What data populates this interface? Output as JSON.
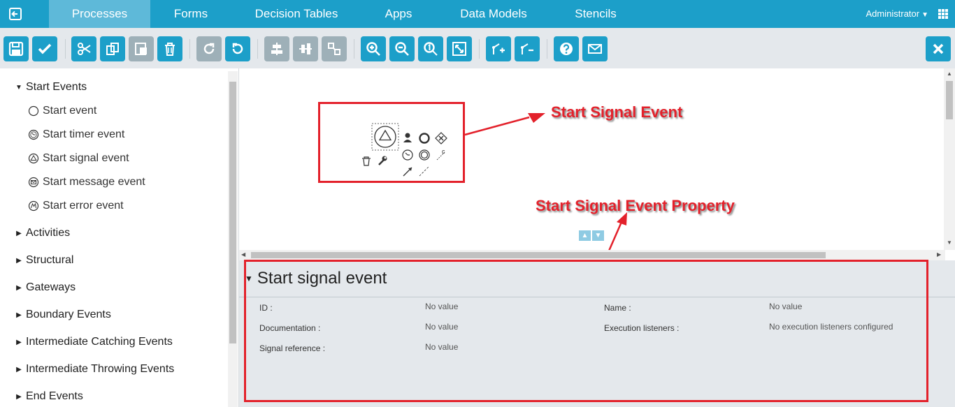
{
  "nav": {
    "tabs": [
      "Processes",
      "Forms",
      "Decision Tables",
      "Apps",
      "Data Models",
      "Stencils"
    ],
    "active_tab": "Processes",
    "user": "Administrator"
  },
  "toolbar": {
    "buttons": [
      "save",
      "validate",
      "cut",
      "copy",
      "paste",
      "delete",
      "redo",
      "undo",
      "align-vertical",
      "align-horizontal",
      "same-size",
      "zoom-in",
      "zoom-out",
      "zoom-actual",
      "zoom-fit",
      "bendpoint-add",
      "bendpoint-remove",
      "help",
      "feedback",
      "close"
    ]
  },
  "palette": {
    "groups": [
      {
        "label": "Start Events",
        "expanded": true,
        "items": [
          "Start event",
          "Start timer event",
          "Start signal event",
          "Start message event",
          "Start error event"
        ]
      },
      {
        "label": "Activities"
      },
      {
        "label": "Structural"
      },
      {
        "label": "Gateways"
      },
      {
        "label": "Boundary Events"
      },
      {
        "label": "Intermediate Catching Events"
      },
      {
        "label": "Intermediate Throwing Events"
      },
      {
        "label": "End Events"
      }
    ]
  },
  "annotations": {
    "signal_event": "Start  Signal Event",
    "signal_property": "Start Signal Event Property"
  },
  "properties": {
    "title": "Start signal event",
    "fields": {
      "id": {
        "label": "ID :",
        "value": "No value"
      },
      "name": {
        "label": "Name :",
        "value": "No value"
      },
      "documentation": {
        "label": "Documentation :",
        "value": "No value"
      },
      "execution_listeners": {
        "label": "Execution listeners :",
        "value": "No execution listeners configured"
      },
      "signal_reference": {
        "label": "Signal reference :",
        "value": "No value"
      }
    }
  },
  "colors": {
    "primary": "#1c9fc9",
    "annotation": "#e3212b",
    "panel": "#e4e8ec"
  }
}
